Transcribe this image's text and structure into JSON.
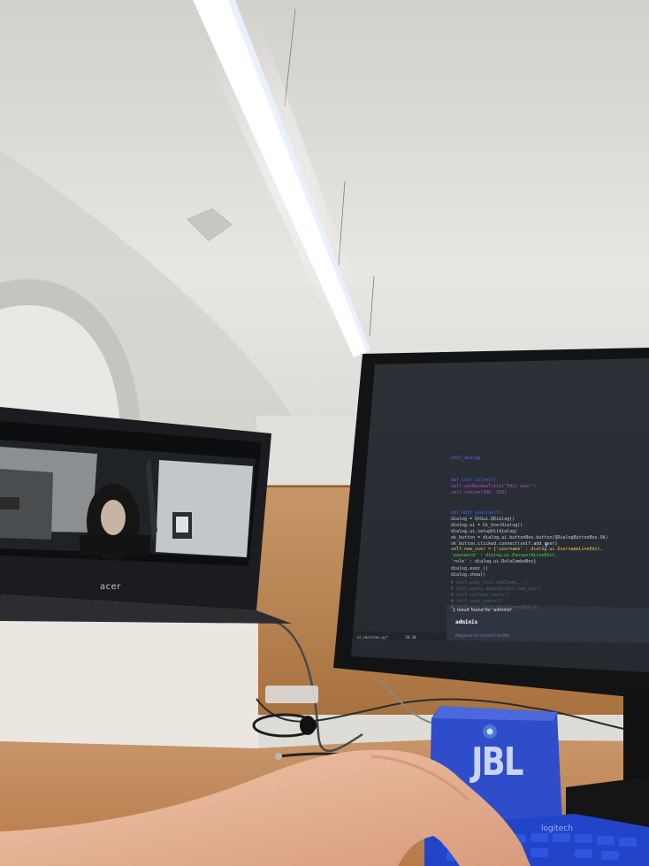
{
  "laptop": {
    "brand_label": "acer"
  },
  "monitor": {
    "code_lines": [
      {
        "text": "    edit_dialog",
        "color": "#3f68ff"
      },
      {
        "text": "    def init_ui(self):",
        "color": "#3f68ff"
      },
      {
        "text": "        self.setWindowTitle(\"Edit user\")",
        "color": "#b34fc8"
      },
      {
        "text": "        self.resize(300, 200)",
        "color": "#b34fc8"
      },
      {
        "text": "    def edit_user(self):",
        "color": "#3f68ff"
      },
      {
        "text": "        dialog = QtGui.QDialog()",
        "color": "#c7cdd4"
      },
      {
        "text": "        dialog.ui = Ui_UserDialog()",
        "color": "#c7cdd4"
      },
      {
        "text": "        dialog.ui.setupUi(dialog)",
        "color": "#c7cdd4"
      },
      {
        "text": "        ok_button = dialog.ui.buttonBox.button(QDialogButtonBox.Ok)",
        "color": "#c7cdd4"
      },
      {
        "text": "        ok_button.clicked.connect(self.add_user)",
        "color": "#c7cdd4"
      },
      {
        "text": "        self.new_user = {'username' : dialog.ui.UsernameLineEdit,",
        "color": "#e6c84a"
      },
      {
        "text": "                         'password' : dialog.ui.PasswordLineEdit,",
        "color": "#4ed24e"
      },
      {
        "text": "                         'role' : dialog.ui.RoleComboBox}",
        "color": "#c7cdd4"
      },
      {
        "text": "        dialog.exec_()",
        "color": "#c7cdd4"
      },
      {
        "text": "        dialog.show()",
        "color": "#c7cdd4"
      },
      {
        "text": "    # self.user_list.addItem(...)",
        "color": "#55606b"
      },
      {
        "text": "    #     self.users.append(self.new_user)",
        "color": "#55606b"
      },
      {
        "text": "    #     self.refresh_users()",
        "color": "#55606b"
      },
      {
        "text": "    #     self.save_users()",
        "color": "#55606b"
      },
      {
        "text": "    # self.user_list.setCurrentRow(0)",
        "color": "#55606b"
      }
    ],
    "search_status": "1 result found for 'adminis'",
    "search_value": "adminis",
    "replace_hint": "Replace in current buffer",
    "filename": "id_skeleton.py*",
    "cursor_pos": "30:30"
  },
  "speaker": {
    "brand_label": "JBL"
  },
  "keyboard": {
    "brand_label": "logitech"
  }
}
